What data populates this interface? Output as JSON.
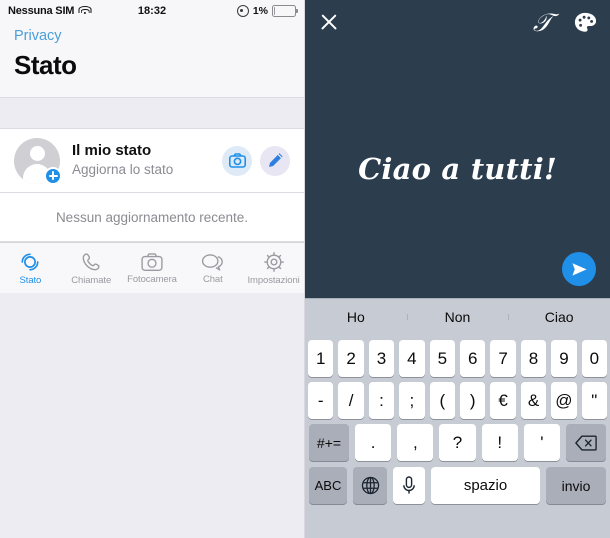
{
  "left": {
    "statusbar": {
      "carrier": "Nessuna SIM",
      "wifi_icon": "wifi-icon",
      "time": "18:32",
      "location_icon": "location-icon",
      "battery_percent": "1%",
      "battery_icon": "battery-icon"
    },
    "nav": {
      "back_label": "Privacy",
      "title": "Stato"
    },
    "status_row": {
      "avatar_icon": "avatar-person-icon",
      "add_badge_icon": "plus-badge-icon",
      "title": "Il mio stato",
      "subtitle": "Aggiorna lo stato",
      "camera_icon": "camera-icon",
      "pencil_icon": "pencil-icon"
    },
    "empty_text": "Nessun aggiornamento recente.",
    "tabs": [
      {
        "label": "Stato",
        "icon": "status-rings-icon",
        "active": true
      },
      {
        "label": "Chiamate",
        "icon": "phone-icon",
        "active": false
      },
      {
        "label": "Fotocamera",
        "icon": "camera-icon",
        "active": false
      },
      {
        "label": "Chat",
        "icon": "chat-bubbles-icon",
        "active": false
      },
      {
        "label": "Impostazioni",
        "icon": "gear-icon",
        "active": false
      }
    ]
  },
  "right": {
    "editor": {
      "background_color": "#2c3d4e",
      "close_icon": "close-icon",
      "font_icon": "text-font-icon",
      "palette_icon": "color-palette-icon",
      "text_value": "Ciao a tutti!",
      "send_icon": "send-icon"
    },
    "keyboard": {
      "predictions": [
        "Ho",
        "Non",
        "Ciao"
      ],
      "row1": [
        "1",
        "2",
        "3",
        "4",
        "5",
        "6",
        "7",
        "8",
        "9",
        "0"
      ],
      "row2": [
        "-",
        "/",
        ":",
        ";",
        "(",
        ")",
        "€",
        "&",
        "@",
        "\""
      ],
      "row3_left": "#+=",
      "row3": [
        ".",
        ",",
        "?",
        "!",
        "'"
      ],
      "row3_right_icon": "backspace-icon",
      "row4": {
        "abc": "ABC",
        "globe_icon": "globe-icon",
        "mic_icon": "microphone-icon",
        "space": "spazio",
        "return": "invio"
      }
    }
  },
  "colors": {
    "accent_blue": "#1f8fe8",
    "link_blue": "#4a9fd8",
    "editor_bg": "#2c3d4e",
    "keyboard_bg": "#C7CBD3",
    "page_bg": "#ECECF2"
  }
}
